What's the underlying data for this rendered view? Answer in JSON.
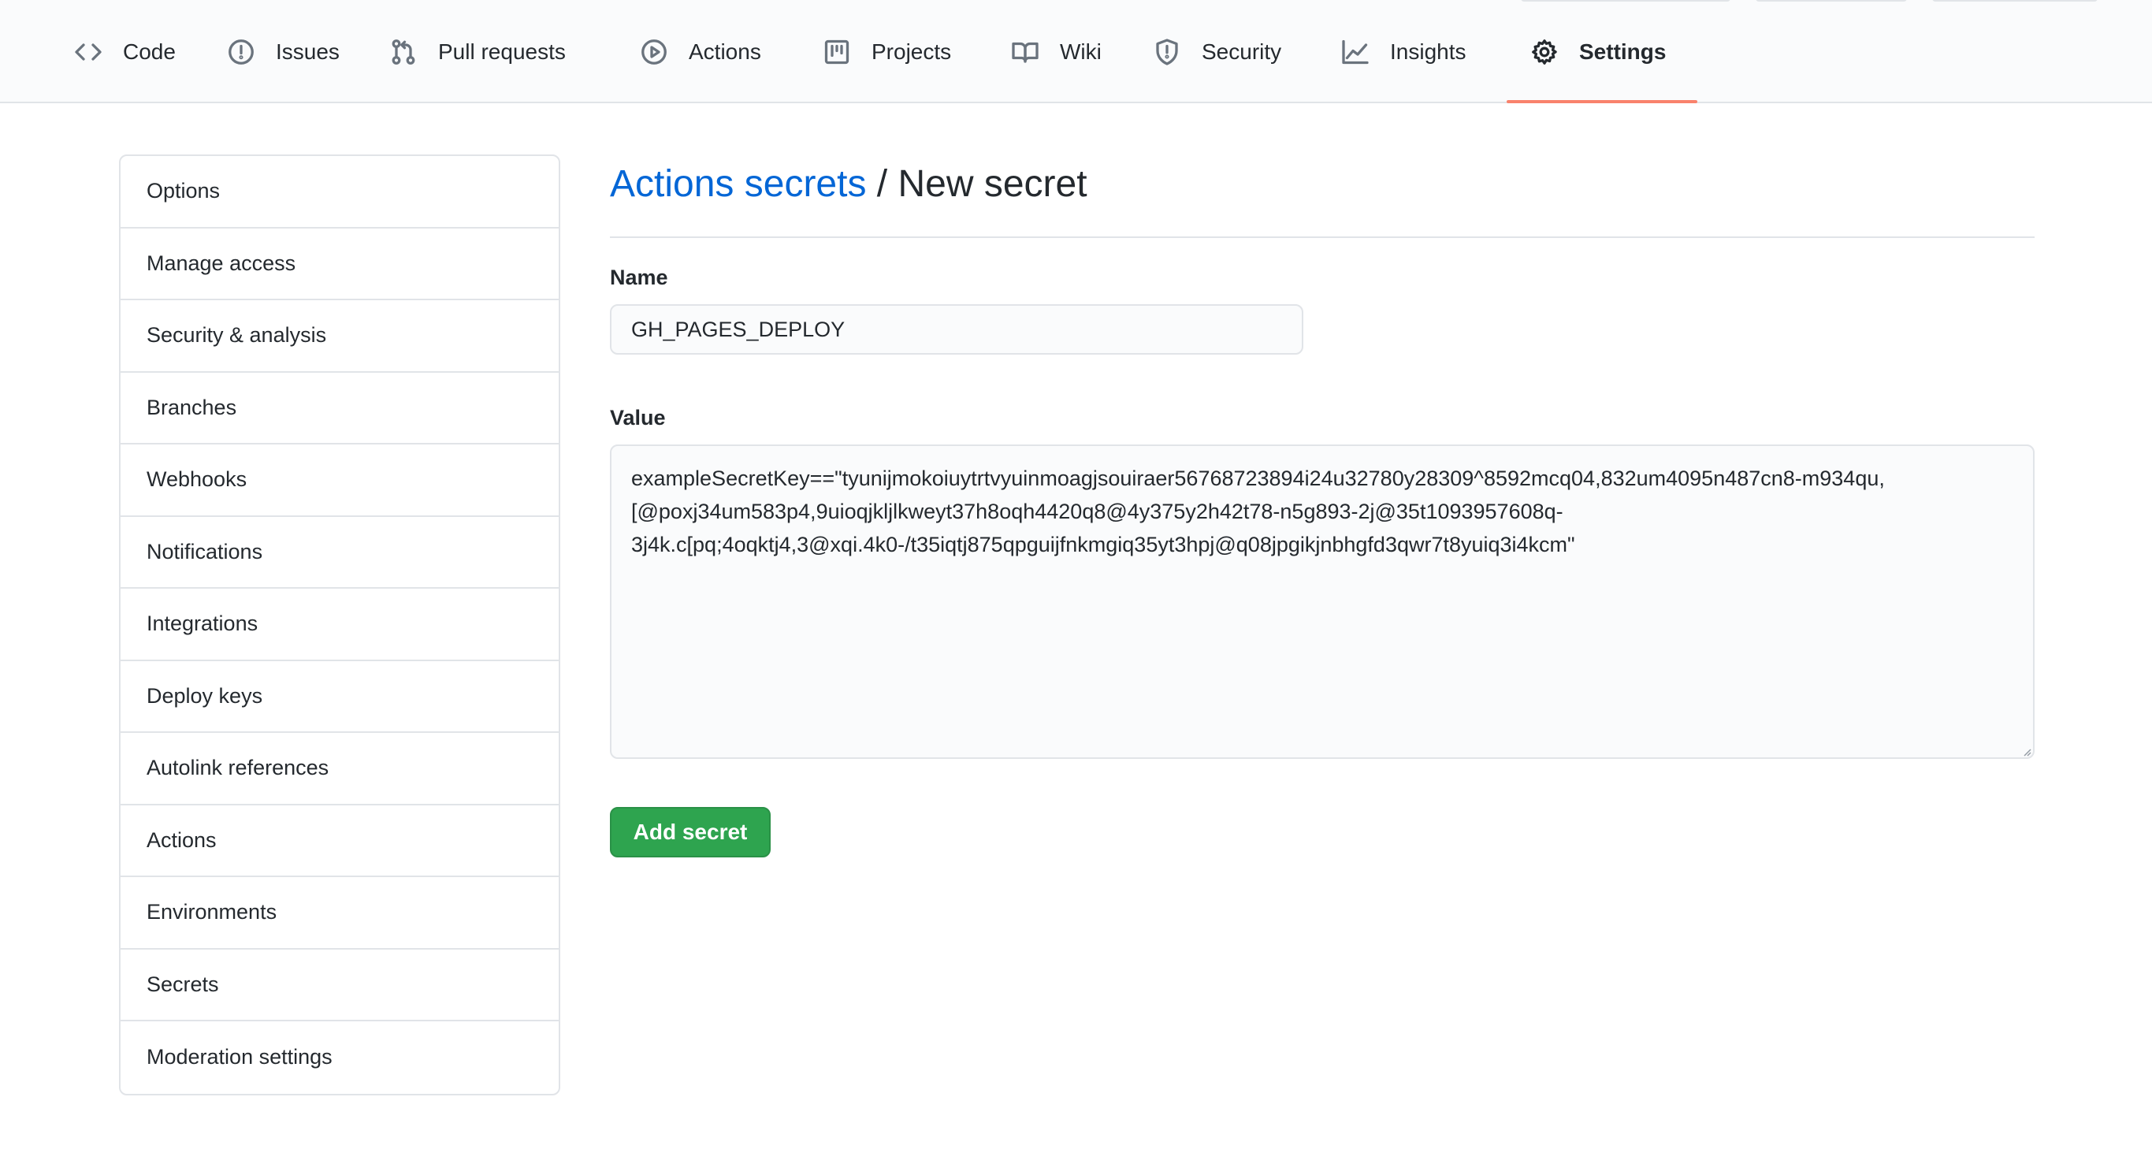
{
  "nav": {
    "tabs": [
      {
        "label": "Code",
        "icon": "code-icon"
      },
      {
        "label": "Issues",
        "icon": "issue-opened-icon"
      },
      {
        "label": "Pull requests",
        "icon": "git-pull-request-icon"
      },
      {
        "label": "Actions",
        "icon": "play-icon"
      },
      {
        "label": "Projects",
        "icon": "project-icon"
      },
      {
        "label": "Wiki",
        "icon": "book-icon"
      },
      {
        "label": "Security",
        "icon": "shield-icon"
      },
      {
        "label": "Insights",
        "icon": "graph-icon"
      },
      {
        "label": "Settings",
        "icon": "gear-icon"
      }
    ],
    "selected": "Settings",
    "accent_color": "#f9826c"
  },
  "sidebar": {
    "items": [
      {
        "label": "Options"
      },
      {
        "label": "Manage access"
      },
      {
        "label": "Security & analysis"
      },
      {
        "label": "Branches"
      },
      {
        "label": "Webhooks"
      },
      {
        "label": "Notifications"
      },
      {
        "label": "Integrations"
      },
      {
        "label": "Deploy keys"
      },
      {
        "label": "Autolink references"
      },
      {
        "label": "Actions"
      },
      {
        "label": "Environments"
      },
      {
        "label": "Secrets"
      },
      {
        "label": "Moderation settings"
      }
    ]
  },
  "main": {
    "breadcrumb_link": "Actions secrets",
    "breadcrumb_separator": " / ",
    "title": "New secret",
    "link_color": "#0366d6"
  },
  "form": {
    "name_label": "Name",
    "name_value": "GH_PAGES_DEPLOY",
    "value_label": "Value",
    "value_text": "exampleSecretKey==\"tyunijmokoiuytrtvyuinmoagjsouiraer56768723894i24u32780y28309^8592mcq04,832um4095n487cn8-m934qu,\n[@poxj34um583p4,9uioqjkljlkweyt37h8oqh4420q8@4y375y2h42t78-n5g893-2j@35t1093957608q-\n3j4k.c[pq;4oqktj4,3@xqi.4k0-/t35iqtj875qpguijfnkmgiq35yt3hpj@q08jpgikjnbhgfd3qwr7t8yuiq3i4kcm\"",
    "submit_label": "Add secret",
    "submit_color": "#2ea44f"
  }
}
